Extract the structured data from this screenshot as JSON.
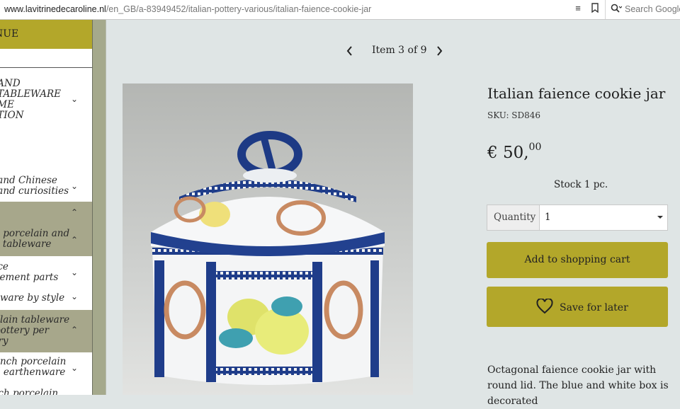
{
  "browser": {
    "url_host": "www.lavitrinedecaroline.nl",
    "url_path": "/en_GB/a-83949452/italian-pottery-various/italian-faience-cookie-jar",
    "search_placeholder": "Search Google",
    "icons": [
      "reader-icon",
      "bookmark-icon",
      "search-icon"
    ]
  },
  "sidebar": {
    "header": "NUE",
    "items": [
      {
        "label": " AND\n TABLEWARE\n ME\n TION",
        "chevron": "down",
        "highlight": false
      },
      {
        "label": " and Chinese\n and curiosities",
        "chevron": "down",
        "highlight": false
      },
      {
        "label": "e",
        "chevron": "up",
        "highlight": true
      },
      {
        "label": "e porcelain and\ny tableware",
        "chevron": "up",
        "highlight": true
      },
      {
        "label": "ice\ncement parts",
        "chevron": "down",
        "highlight": false
      },
      {
        "label": "eware by style",
        "chevron": "down",
        "highlight": false
      },
      {
        "label": "elain tableware\npottery per\ntry",
        "chevron": "up",
        "highlight": true
      },
      {
        "label": "ench porcelain\nd earthenware",
        "chevron": "down",
        "highlight": false
      },
      {
        "label": "tch porcelain",
        "chevron": "",
        "highlight": false
      }
    ]
  },
  "pager": {
    "label": "Item 3 of 9"
  },
  "product": {
    "title": "Italian faience cookie jar",
    "sku": "SKU: SD846",
    "price_main": "€ 50,",
    "price_cents": "00",
    "stock": "Stock 1 pc.",
    "quantity_label": "Quantity",
    "quantity_value": "1",
    "add_to_cart": "Add to shopping cart",
    "save_for_later": "Save for later",
    "description": "Octagonal faience cookie jar with round lid. The blue and white box is decorated"
  },
  "colors": {
    "accent": "#b3a72a",
    "sidebar_highlight": "#a7a78b",
    "page_bg": "#dfe5e5"
  }
}
